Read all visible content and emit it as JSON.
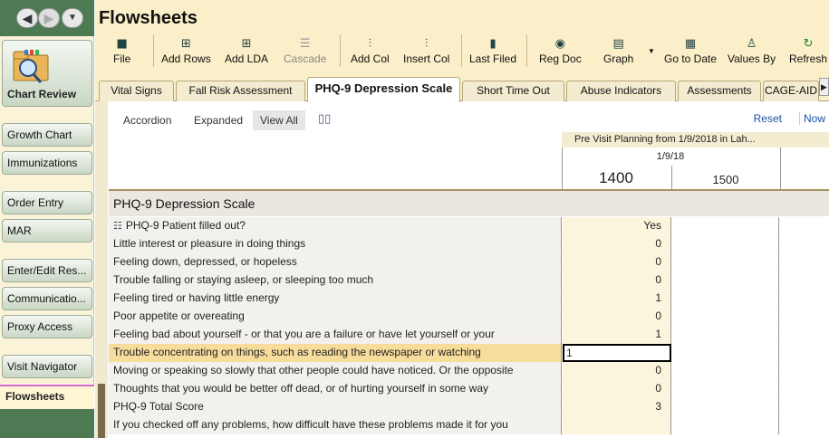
{
  "app": {
    "title": "Flowsheets"
  },
  "sidebar": {
    "back_icon": "◀",
    "forward_icon": "▶",
    "menu_icon": "▼",
    "chart_review": "Chart Review",
    "items": [
      {
        "label": "Growth Chart"
      },
      {
        "label": "Immunizations"
      },
      {
        "label": "Order Entry"
      },
      {
        "label": "MAR"
      },
      {
        "label": "Enter/Edit Res..."
      },
      {
        "label": "Communicatio..."
      },
      {
        "label": "Proxy Access"
      },
      {
        "label": "Visit Navigator"
      }
    ],
    "active": "Flowsheets"
  },
  "toolbar": {
    "file": "File",
    "add_rows": "Add Rows",
    "add_lda": "Add LDA",
    "cascade": "Cascade",
    "add_col": "Add Col",
    "insert_col": "Insert Col",
    "last_filed": "Last Filed",
    "reg_doc": "Reg Doc",
    "graph": "Graph",
    "go_to_date": "Go to Date",
    "values_by": "Values By",
    "refresh": "Refresh"
  },
  "tabs": [
    {
      "label": "Vital Signs"
    },
    {
      "label": "Fall Risk Assessment"
    },
    {
      "label": "PHQ-9 Depression Scale"
    },
    {
      "label": "Short Time Out"
    },
    {
      "label": "Abuse Indicators"
    },
    {
      "label": "Assessments"
    },
    {
      "label": "CAGE-AID"
    }
  ],
  "views": {
    "accordion": "Accordion",
    "expanded": "Expanded",
    "view_all": "View All",
    "reset": "Reset",
    "now": "Now"
  },
  "columns": {
    "encounter": "Pre Visit Planning from 1/9/2018 in Lah...",
    "date": "1/9/18",
    "time1": "1400",
    "time2": "1500"
  },
  "section": {
    "title": "PHQ-9 Depression Scale"
  },
  "rows": [
    {
      "label": "PHQ-9 Patient filled out?",
      "v1": "Yes"
    },
    {
      "label": "Little interest or pleasure in doing things",
      "v1": "0"
    },
    {
      "label": "Feeling down, depressed, or hopeless",
      "v1": "0"
    },
    {
      "label": "Trouble falling or staying asleep, or sleeping too much",
      "v1": "0"
    },
    {
      "label": "Feeling tired or having little energy",
      "v1": "1"
    },
    {
      "label": "Poor appetite or overeating",
      "v1": "0"
    },
    {
      "label": "Feeling bad about yourself - or that you are a failure or have let yourself or your",
      "v1": "1"
    },
    {
      "label": "Trouble concentrating on things, such as reading the newspaper or watching",
      "v1": "1"
    },
    {
      "label": "Moving or speaking so slowly that other people could have noticed. Or the opposite",
      "v1": "0"
    },
    {
      "label": "Thoughts that you would be better off dead, or of hurting yourself in some way",
      "v1": "0"
    },
    {
      "label": "PHQ-9 Total Score",
      "v1": "3"
    },
    {
      "label": "If you checked off any problems, how difficult have these problems made it for you",
      "v1": ""
    }
  ]
}
